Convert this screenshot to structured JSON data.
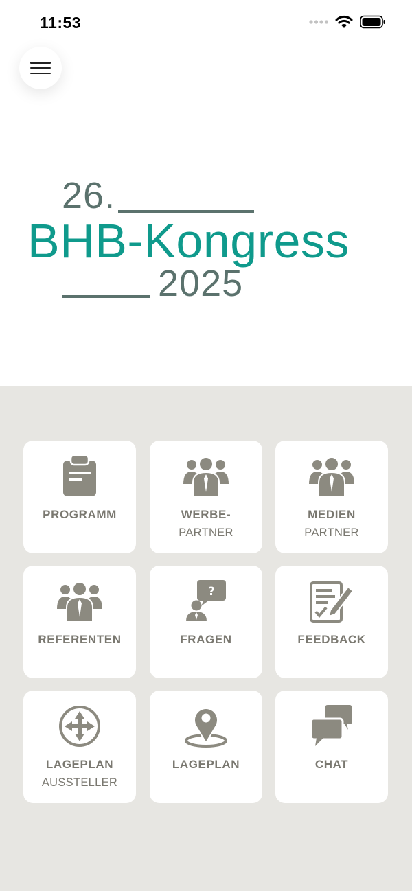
{
  "status_bar": {
    "time": "11:53",
    "icons": [
      "signal-dots-icon",
      "wifi-icon",
      "battery-icon"
    ]
  },
  "menu_button": {
    "icon": "hamburger-icon"
  },
  "logo": {
    "line1": "26.",
    "line2": "BHB-Kongress",
    "line3": "2025",
    "colors": {
      "primary": "#0f9a8c",
      "secondary": "#5b726d"
    }
  },
  "tiles": [
    {
      "icon": "clipboard-icon",
      "label": "PROGRAMM",
      "sub": ""
    },
    {
      "icon": "group-icon",
      "label": "WERBE-",
      "sub": "PARTNER"
    },
    {
      "icon": "group-icon",
      "label": "MEDIEN",
      "sub": "PARTNER"
    },
    {
      "icon": "group-icon",
      "label": "REFERENTEN",
      "sub": ""
    },
    {
      "icon": "question-bubble-icon",
      "label": "FRAGEN",
      "sub": ""
    },
    {
      "icon": "edit-document-icon",
      "label": "FEEDBACK",
      "sub": ""
    },
    {
      "icon": "compass-arrows-icon",
      "label": "LAGEPLAN",
      "sub": "AUSSTELLER"
    },
    {
      "icon": "map-pin-icon",
      "label": "LAGEPLAN",
      "sub": ""
    },
    {
      "icon": "chat-bubbles-icon",
      "label": "CHAT",
      "sub": ""
    }
  ],
  "colors": {
    "tile_background": "#ffffff",
    "area_background": "#e7e6e2",
    "icon_color": "#8c8a80",
    "label_color": "#7a7870"
  }
}
